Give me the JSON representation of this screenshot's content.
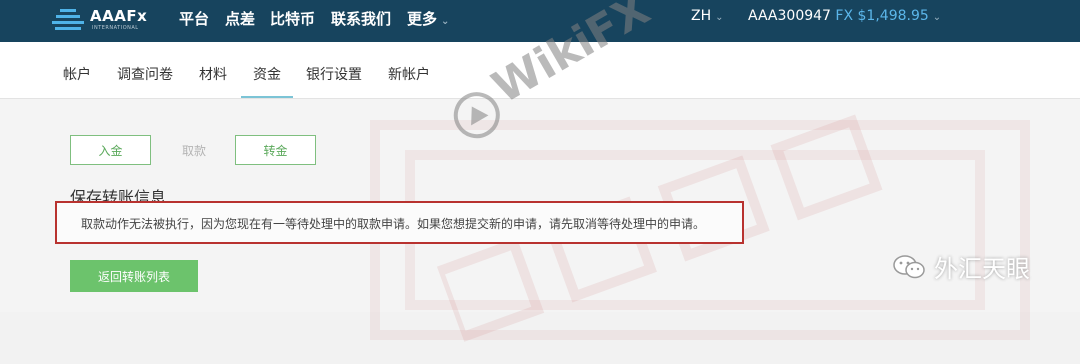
{
  "brand": {
    "name": "AAAFx",
    "subtitle": "INTERNATIONAL"
  },
  "topnav": {
    "items": [
      {
        "label": "平台"
      },
      {
        "label": "点差"
      },
      {
        "label": "比特币"
      },
      {
        "label": "联系我们"
      },
      {
        "label": "更多"
      }
    ],
    "language": "ZH",
    "account_id": "AAA300947",
    "balance": "FX $1,498.95",
    "chevron_icon": "chevron-down-icon"
  },
  "subtabs": {
    "items": [
      {
        "label": "帐户"
      },
      {
        "label": "调查问卷"
      },
      {
        "label": "材料"
      },
      {
        "label": "资金",
        "active": true
      },
      {
        "label": "银行设置"
      },
      {
        "label": "新帐户"
      }
    ]
  },
  "funds": {
    "buttons": {
      "deposit": "入金",
      "withdraw": "取款",
      "transfer": "转金"
    },
    "section_title": "保存转账信息",
    "error_message": "取款动作无法被执行，因为您现在有一等待处理中的取款申请。如果您想提交新的申请，请先取消等待处理中的申请。",
    "back_button": "返回转账列表"
  },
  "overlays": {
    "watermark": "WikiFX",
    "wechat_caption": "外汇天眼",
    "stamp_text": "外汇天眼",
    "wechat_icon": "wechat-icon"
  },
  "colors": {
    "topbar": "#17445e",
    "balance": "#5bb6ea",
    "success_green": "#6cc36c",
    "alert_border": "#b8322f"
  }
}
